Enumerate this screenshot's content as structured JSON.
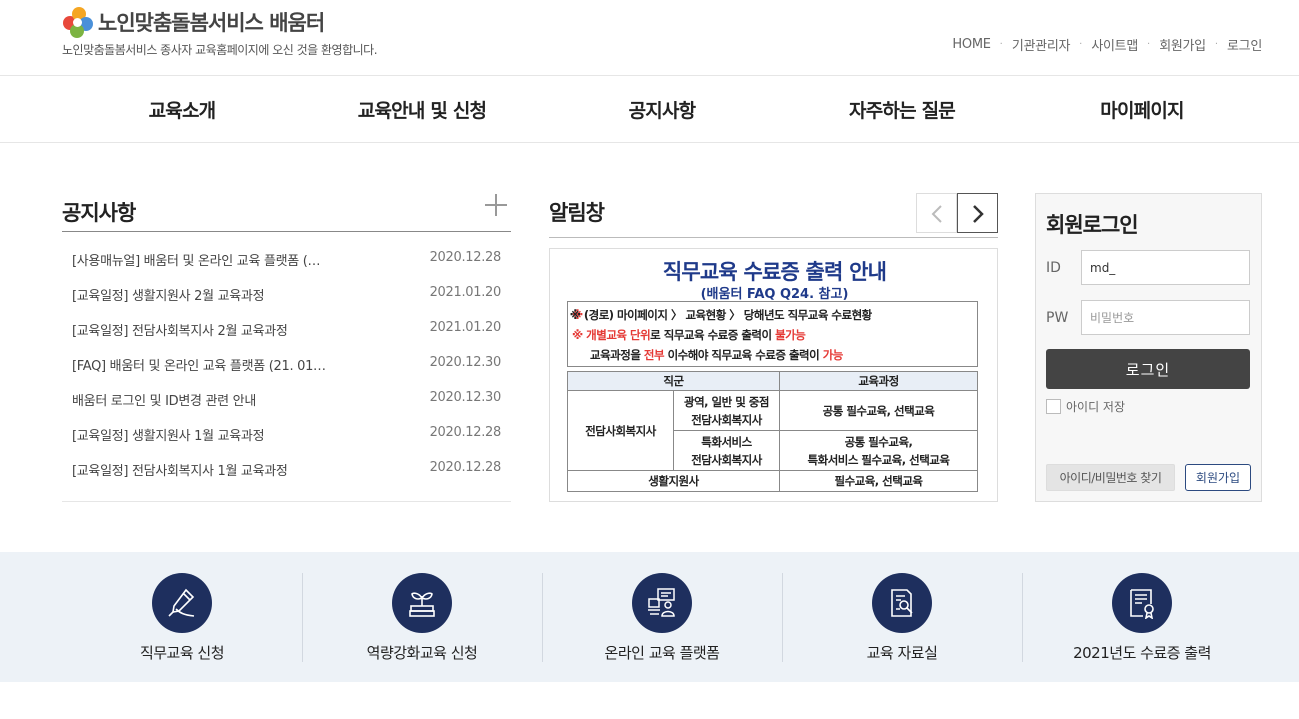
{
  "header": {
    "site_name": "노인맞춤돌봄서비스 배움터",
    "tagline": "노인맞춤돌봄서비스 종사자 교육홈페이지에 오신 것을 환영합니다.",
    "util_links": [
      "HOME",
      "기관관리자",
      "사이트맵",
      "회원가입",
      "로그인"
    ],
    "logo_colors": [
      "#e8483b",
      "#f5a623",
      "#4a90d9",
      "#7cb342"
    ]
  },
  "gnb": [
    "교육소개",
    "교육안내 및 신청",
    "공지사항",
    "자주하는 질문",
    "마이페이지"
  ],
  "notice": {
    "title": "공지사항",
    "more_icon": "plus-icon",
    "items": [
      {
        "title": "[사용매뉴얼] 배움터 및 온라인 교육 플랫폼 (…",
        "date": "2020.12.28"
      },
      {
        "title": "[교육일정] 생활지원사 2월 교육과정",
        "date": "2021.01.20"
      },
      {
        "title": "[교육일정] 전담사회복지사 2월 교육과정",
        "date": "2021.01.20"
      },
      {
        "title": "[FAQ] 배움터 및 온라인 교육 플랫폼 (21. 01…",
        "date": "2020.12.30"
      },
      {
        "title": "배움터 로그인 및 ID변경 관련 안내",
        "date": "2020.12.30"
      },
      {
        "title": "[교육일정] 생활지원사 1월 교육과정",
        "date": "2020.12.28"
      },
      {
        "title": "[교육일정] 전담사회복지사 1월 교육과정",
        "date": "2020.12.28"
      }
    ]
  },
  "alert": {
    "title": "알림창",
    "prev_icon": "chevron-left-icon",
    "next_icon": "chevron-right-icon",
    "banner": {
      "title": "직무교육 수료증 출력 안내",
      "subtitle": "(배움터 FAQ Q24. 참고)",
      "line1": "※ (경로) 마이페이지 〉 교육현황 〉 당해년도 직무교육 수료현황",
      "line2_a": "※ 개별교육 단위",
      "line2_b": "로 직무교육 수료증 출력이 ",
      "line2_c": "불가능",
      "line3_a": "교육과정을 ",
      "line3_b": "전부",
      "line3_c": " 이수해야 직무교육 수료증 출력이 ",
      "line3_d": "가능",
      "table": {
        "headers": [
          "직군",
          "교육과정"
        ],
        "group1": "전담사회복지사",
        "row1_sub_a": "광역, 일반 및 중점",
        "row1_sub_b": "전담사회복지사",
        "row1_course": "공통 필수교육, 선택교육",
        "row2_sub_a": "특화서비스",
        "row2_sub_b": "전담사회복지사",
        "row2_course_a": "공통 필수교육,",
        "row2_course_b": "특화서비스 필수교육, 선택교육",
        "group2": "생활지원사",
        "row3_course": "필수교육, 선택교육"
      }
    }
  },
  "login": {
    "title": "회원로그인",
    "id_label": "ID",
    "id_value": "md_",
    "pw_label": "PW",
    "pw_placeholder": "비밀번호",
    "submit": "로그인",
    "save_id": "아이디 저장",
    "find": "아이디/비밀번호 찾기",
    "join": "회원가입"
  },
  "quick_menu": [
    {
      "label": "직무교육 신청",
      "icon": "pen-icon"
    },
    {
      "label": "역량강화교육 신청",
      "icon": "sprout-book-icon"
    },
    {
      "label": "온라인 교육 플랫폼",
      "icon": "online-lecture-icon"
    },
    {
      "label": "교육 자료실",
      "icon": "document-search-icon"
    },
    {
      "label": "2021년도 수료증 출력",
      "icon": "certificate-icon"
    }
  ],
  "colors": {
    "navy": "#1e2f5e",
    "banner_blue": "#1f3a8a",
    "alert_red": "#e53935",
    "quick_bg": "#edf2f7"
  }
}
